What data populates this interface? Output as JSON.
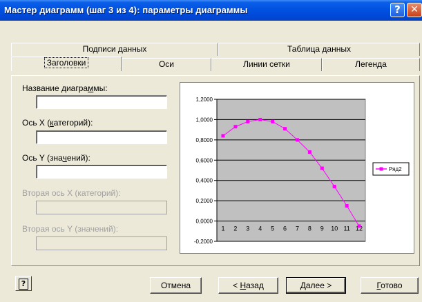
{
  "window": {
    "title": "Мастер диаграмм (шаг 3 из 4): параметры диаграммы",
    "help_glyph": "?",
    "close_glyph": "✕"
  },
  "tabs_back": [
    {
      "label": "Подписи данных"
    },
    {
      "label": "Таблица данных"
    }
  ],
  "tabs_front": [
    {
      "label": "Заголовки",
      "active": true
    },
    {
      "label": "Оси"
    },
    {
      "label": "Линии сетки"
    },
    {
      "label": "Легенда"
    }
  ],
  "fields": {
    "chart_title": {
      "label_pre": "Название диагра",
      "label_u": "м",
      "label_post": "мы:",
      "value": ""
    },
    "x_axis": {
      "label_pre": "Ось X (",
      "label_u": "к",
      "label_post": "атегорий):",
      "value": ""
    },
    "y_axis": {
      "label_pre": "Ось Y (зна",
      "label_u": "ч",
      "label_post": "ений):",
      "value": ""
    },
    "x2_axis": {
      "label": "Вторая ось X (категорий):",
      "value": ""
    },
    "y2_axis": {
      "label": "Вторая ось Y (значений):",
      "value": ""
    }
  },
  "buttons": {
    "help": "?",
    "cancel": "Отмена",
    "back_pre": "< ",
    "back_u": "Н",
    "back_post": "азад",
    "next": "Далее >",
    "finish_u": "Г",
    "finish_post": "отово"
  },
  "colors": {
    "plot_area": "#c0c0c0",
    "series": "#ff00ff",
    "titlebar": "#0054e3"
  },
  "chart_data": {
    "type": "line",
    "x": [
      "1",
      "2",
      "3",
      "4",
      "5",
      "6",
      "7",
      "8",
      "9",
      "10",
      "11",
      "12"
    ],
    "series": [
      {
        "name": "Ряд2",
        "values": [
          0.84,
          0.93,
          0.98,
          1.0,
          0.98,
          0.91,
          0.8,
          0.68,
          0.52,
          0.34,
          0.15,
          -0.05
        ]
      }
    ],
    "ylim": [
      -0.2,
      1.2
    ],
    "yticks": [
      "1,2000",
      "1,0000",
      "0,8000",
      "0,6000",
      "0,4000",
      "0,2000",
      "0,0000",
      "-0,2000"
    ],
    "grid": true,
    "legend": "right"
  }
}
